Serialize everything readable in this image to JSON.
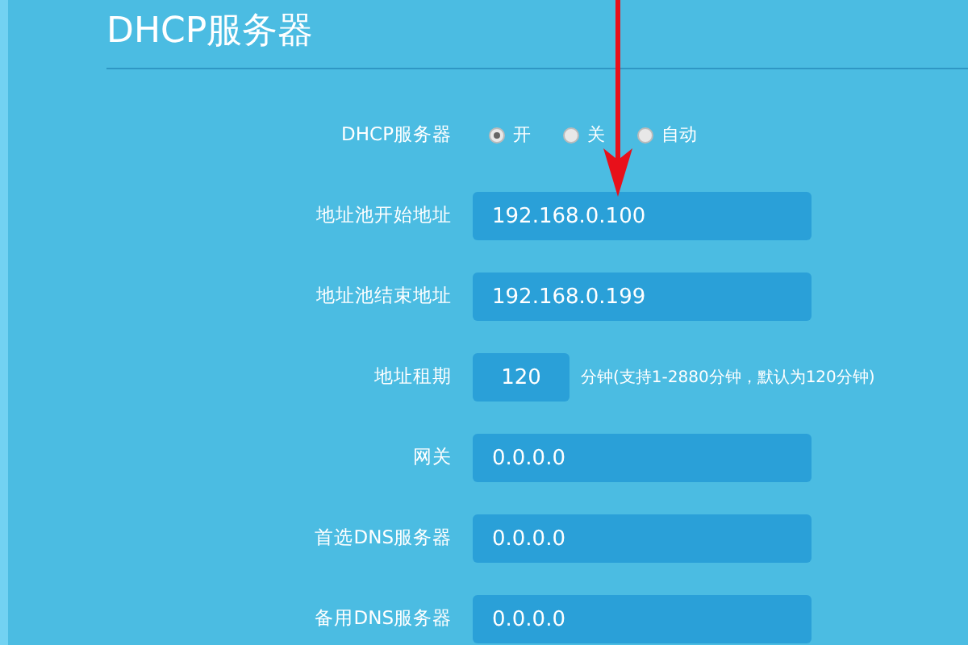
{
  "title": "DHCP服务器",
  "dhcp_server": {
    "label": "DHCP服务器",
    "options": [
      {
        "label": "开",
        "selected": true
      },
      {
        "label": "关",
        "selected": false
      },
      {
        "label": "自动",
        "selected": false
      }
    ]
  },
  "fields": [
    {
      "label": "地址池开始地址",
      "value": "192.168.0.100",
      "kind": "wide"
    },
    {
      "label": "地址池结束地址",
      "value": "192.168.0.199",
      "kind": "wide"
    },
    {
      "label": "地址租期",
      "value": "120",
      "kind": "short",
      "hint": "分钟(支持1-2880分钟，默认为120分钟)"
    },
    {
      "label": "网关",
      "value": "0.0.0.0",
      "kind": "wide"
    },
    {
      "label": "首选DNS服务器",
      "value": "0.0.0.0",
      "kind": "wide"
    },
    {
      "label": "备用DNS服务器",
      "value": "0.0.0.0",
      "kind": "wide"
    }
  ]
}
